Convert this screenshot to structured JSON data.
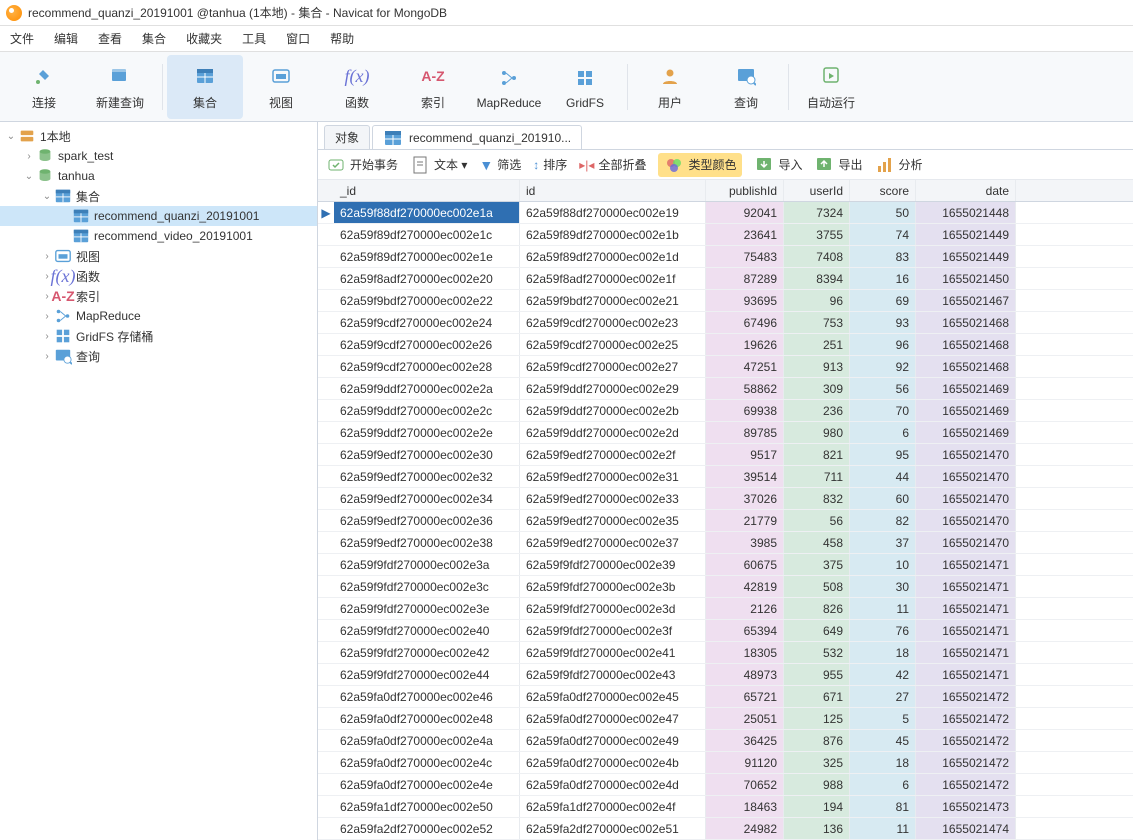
{
  "title": "recommend_quanzi_20191001 @tanhua (1本地) - 集合 - Navicat for MongoDB",
  "menu": [
    "文件",
    "编辑",
    "查看",
    "集合",
    "收藏夹",
    "工具",
    "窗口",
    "帮助"
  ],
  "toolbar": [
    {
      "label": "连接",
      "icon": "plug"
    },
    {
      "label": "新建查询",
      "icon": "grid-plus"
    },
    {
      "label": "集合",
      "icon": "table",
      "active": true
    },
    {
      "label": "视图",
      "icon": "view"
    },
    {
      "label": "函数",
      "icon": "fx"
    },
    {
      "label": "索引",
      "icon": "az"
    },
    {
      "label": "MapReduce",
      "icon": "mapreduce"
    },
    {
      "label": "GridFS",
      "icon": "gridfs"
    },
    {
      "label": "用户",
      "icon": "user"
    },
    {
      "label": "查询",
      "icon": "query"
    },
    {
      "label": "自动运行",
      "icon": "autorun"
    }
  ],
  "tree": {
    "root": "1本地",
    "dbs": [
      {
        "name": "spark_test"
      },
      {
        "name": "tanhua",
        "expanded": true,
        "children": [
          {
            "name": "集合",
            "expanded": true,
            "children": [
              {
                "name": "recommend_quanzi_20191001",
                "selected": true
              },
              {
                "name": "recommend_video_20191001"
              }
            ]
          },
          {
            "name": "视图",
            "icon": "view"
          },
          {
            "name": "函数",
            "icon": "fx"
          },
          {
            "name": "索引",
            "icon": "az"
          },
          {
            "name": "MapReduce",
            "icon": "mapreduce"
          },
          {
            "name": "GridFS 存储桶",
            "icon": "gridfs"
          },
          {
            "name": "查询",
            "icon": "query"
          }
        ]
      }
    ]
  },
  "tabs": [
    {
      "label": "对象"
    },
    {
      "label": "recommend_quanzi_201910...",
      "active": true,
      "icon": "table"
    }
  ],
  "subtoolbar": [
    {
      "label": "开始事务",
      "icon": "txn"
    },
    {
      "label": "文本 ▾",
      "icon": "doc"
    },
    {
      "label": "筛选",
      "icon": "filter"
    },
    {
      "label": "排序",
      "icon": "sort"
    },
    {
      "label": "全部折叠",
      "icon": "collapse"
    },
    {
      "label": "类型颜色",
      "icon": "colors",
      "hl": true
    },
    {
      "label": "导入",
      "icon": "import"
    },
    {
      "label": "导出",
      "icon": "export"
    },
    {
      "label": "分析",
      "icon": "chart"
    }
  ],
  "columns": [
    "_id",
    "id",
    "publishId",
    "userId",
    "score",
    "date"
  ],
  "rows": [
    [
      "62a59f88df270000ec002e1a",
      "62a59f88df270000ec002e19",
      "92041",
      "7324",
      "50",
      "1655021448"
    ],
    [
      "62a59f89df270000ec002e1c",
      "62a59f89df270000ec002e1b",
      "23641",
      "3755",
      "74",
      "1655021449"
    ],
    [
      "62a59f89df270000ec002e1e",
      "62a59f89df270000ec002e1d",
      "75483",
      "7408",
      "83",
      "1655021449"
    ],
    [
      "62a59f8adf270000ec002e20",
      "62a59f8adf270000ec002e1f",
      "87289",
      "8394",
      "16",
      "1655021450"
    ],
    [
      "62a59f9bdf270000ec002e22",
      "62a59f9bdf270000ec002e21",
      "93695",
      "96",
      "69",
      "1655021467"
    ],
    [
      "62a59f9cdf270000ec002e24",
      "62a59f9cdf270000ec002e23",
      "67496",
      "753",
      "93",
      "1655021468"
    ],
    [
      "62a59f9cdf270000ec002e26",
      "62a59f9cdf270000ec002e25",
      "19626",
      "251",
      "96",
      "1655021468"
    ],
    [
      "62a59f9cdf270000ec002e28",
      "62a59f9cdf270000ec002e27",
      "47251",
      "913",
      "92",
      "1655021468"
    ],
    [
      "62a59f9ddf270000ec002e2a",
      "62a59f9ddf270000ec002e29",
      "58862",
      "309",
      "56",
      "1655021469"
    ],
    [
      "62a59f9ddf270000ec002e2c",
      "62a59f9ddf270000ec002e2b",
      "69938",
      "236",
      "70",
      "1655021469"
    ],
    [
      "62a59f9ddf270000ec002e2e",
      "62a59f9ddf270000ec002e2d",
      "89785",
      "980",
      "6",
      "1655021469"
    ],
    [
      "62a59f9edf270000ec002e30",
      "62a59f9edf270000ec002e2f",
      "9517",
      "821",
      "95",
      "1655021470"
    ],
    [
      "62a59f9edf270000ec002e32",
      "62a59f9edf270000ec002e31",
      "39514",
      "711",
      "44",
      "1655021470"
    ],
    [
      "62a59f9edf270000ec002e34",
      "62a59f9edf270000ec002e33",
      "37026",
      "832",
      "60",
      "1655021470"
    ],
    [
      "62a59f9edf270000ec002e36",
      "62a59f9edf270000ec002e35",
      "21779",
      "56",
      "82",
      "1655021470"
    ],
    [
      "62a59f9edf270000ec002e38",
      "62a59f9edf270000ec002e37",
      "3985",
      "458",
      "37",
      "1655021470"
    ],
    [
      "62a59f9fdf270000ec002e3a",
      "62a59f9fdf270000ec002e39",
      "60675",
      "375",
      "10",
      "1655021471"
    ],
    [
      "62a59f9fdf270000ec002e3c",
      "62a59f9fdf270000ec002e3b",
      "42819",
      "508",
      "30",
      "1655021471"
    ],
    [
      "62a59f9fdf270000ec002e3e",
      "62a59f9fdf270000ec002e3d",
      "2126",
      "826",
      "11",
      "1655021471"
    ],
    [
      "62a59f9fdf270000ec002e40",
      "62a59f9fdf270000ec002e3f",
      "65394",
      "649",
      "76",
      "1655021471"
    ],
    [
      "62a59f9fdf270000ec002e42",
      "62a59f9fdf270000ec002e41",
      "18305",
      "532",
      "18",
      "1655021471"
    ],
    [
      "62a59f9fdf270000ec002e44",
      "62a59f9fdf270000ec002e43",
      "48973",
      "955",
      "42",
      "1655021471"
    ],
    [
      "62a59fa0df270000ec002e46",
      "62a59fa0df270000ec002e45",
      "65721",
      "671",
      "27",
      "1655021472"
    ],
    [
      "62a59fa0df270000ec002e48",
      "62a59fa0df270000ec002e47",
      "25051",
      "125",
      "5",
      "1655021472"
    ],
    [
      "62a59fa0df270000ec002e4a",
      "62a59fa0df270000ec002e49",
      "36425",
      "876",
      "45",
      "1655021472"
    ],
    [
      "62a59fa0df270000ec002e4c",
      "62a59fa0df270000ec002e4b",
      "91120",
      "325",
      "18",
      "1655021472"
    ],
    [
      "62a59fa0df270000ec002e4e",
      "62a59fa0df270000ec002e4d",
      "70652",
      "988",
      "6",
      "1655021472"
    ],
    [
      "62a59fa1df270000ec002e50",
      "62a59fa1df270000ec002e4f",
      "18463",
      "194",
      "81",
      "1655021473"
    ],
    [
      "62a59fa2df270000ec002e52",
      "62a59fa2df270000ec002e51",
      "24982",
      "136",
      "11",
      "1655021474"
    ]
  ]
}
